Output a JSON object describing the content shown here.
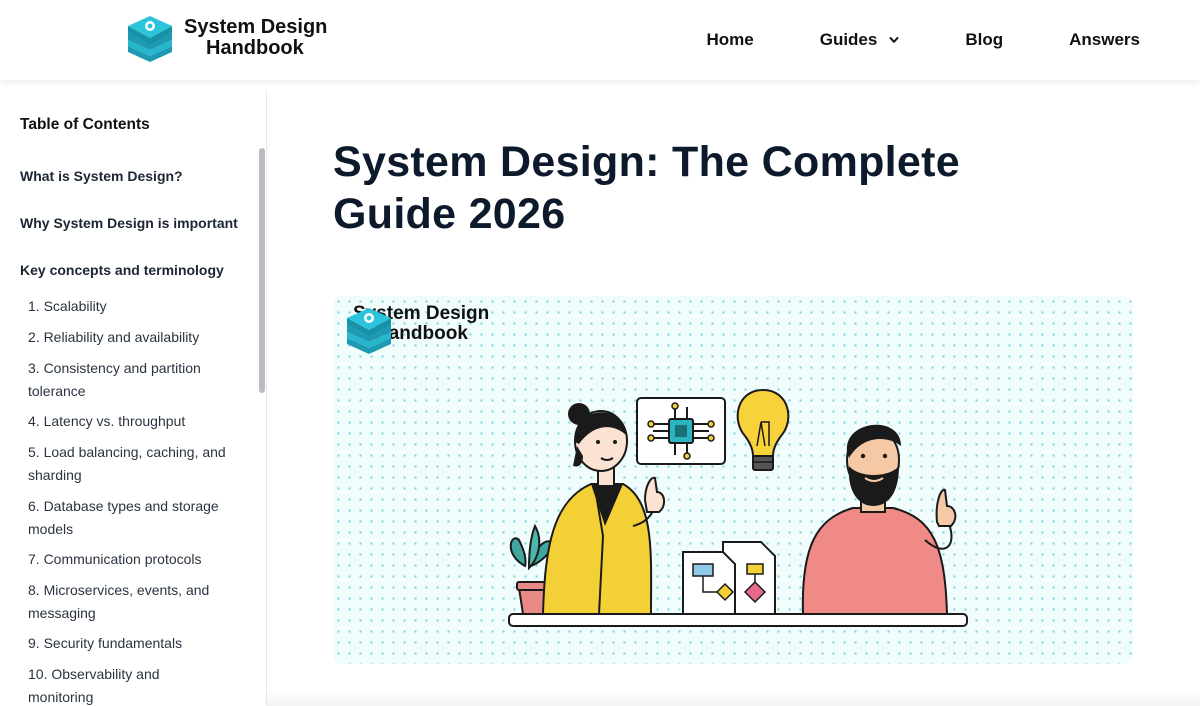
{
  "header": {
    "brand_line1": "System Design",
    "brand_line2": "Handbook",
    "nav": {
      "home": "Home",
      "guides": "Guides",
      "blog": "Blog",
      "answers": "Answers"
    }
  },
  "sidebar": {
    "title": "Table of Contents",
    "sections": [
      "What is System Design?",
      "Why System Design is important",
      "Key concepts and terminology"
    ],
    "items": [
      "1. Scalability",
      "2. Reliability and availability",
      "3. Consistency and partition tolerance",
      "4. Latency vs. throughput",
      "5. Load balancing, caching, and sharding",
      "6. Database types and storage models",
      "7. Communication protocols",
      "8. Microservices, events, and messaging",
      "9. Security fundamentals",
      "10. Observability and monitoring"
    ]
  },
  "main": {
    "title": "System Design: The Complete Guide 2026",
    "hero_brand_line1": "System Design",
    "hero_brand_line2": "Handbook"
  },
  "colors": {
    "brand_teal": "#1aa7c1",
    "title_navy": "#0c1a2b"
  },
  "icons": {
    "logo": "stacked-cube-logo-icon",
    "guides_dropdown": "chevron-down-icon"
  }
}
